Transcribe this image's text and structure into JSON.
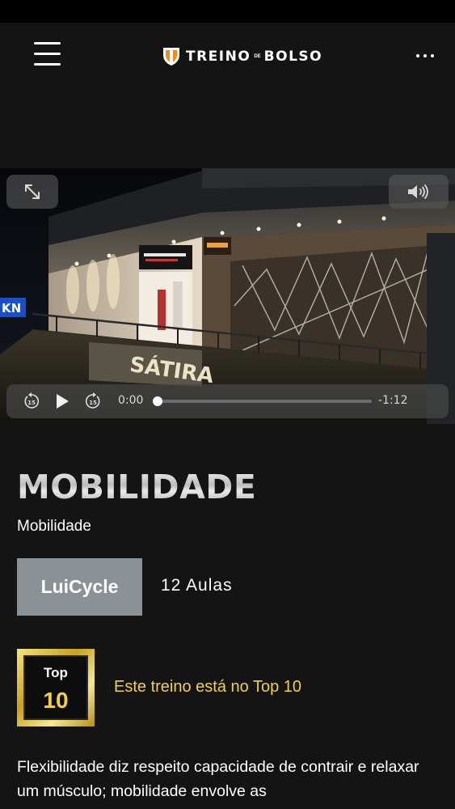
{
  "header": {
    "brand_left": "TREINO",
    "brand_mid": "DE",
    "brand_right": "BOLSO"
  },
  "video": {
    "current_time": "0:00",
    "remaining_time": "-1:12",
    "progress": 0.0,
    "skip_back_seconds": "15",
    "skip_forward_seconds": "15"
  },
  "workout": {
    "title": "MOBILIDADE",
    "category": "Mobilidade",
    "teacher": "LuiCycle",
    "lessons": "12 Aulas"
  },
  "top10": {
    "badge_top": "Top",
    "badge_number": "10",
    "message": "Este treino está no Top 10"
  },
  "description": "Flexibilidade diz respeito capacidade de contrair e relaxar um músculo; mobilidade envolve as",
  "colors": {
    "background": "#141414",
    "gold": "#f0cf4a",
    "teacher_button": "#8a9297"
  }
}
